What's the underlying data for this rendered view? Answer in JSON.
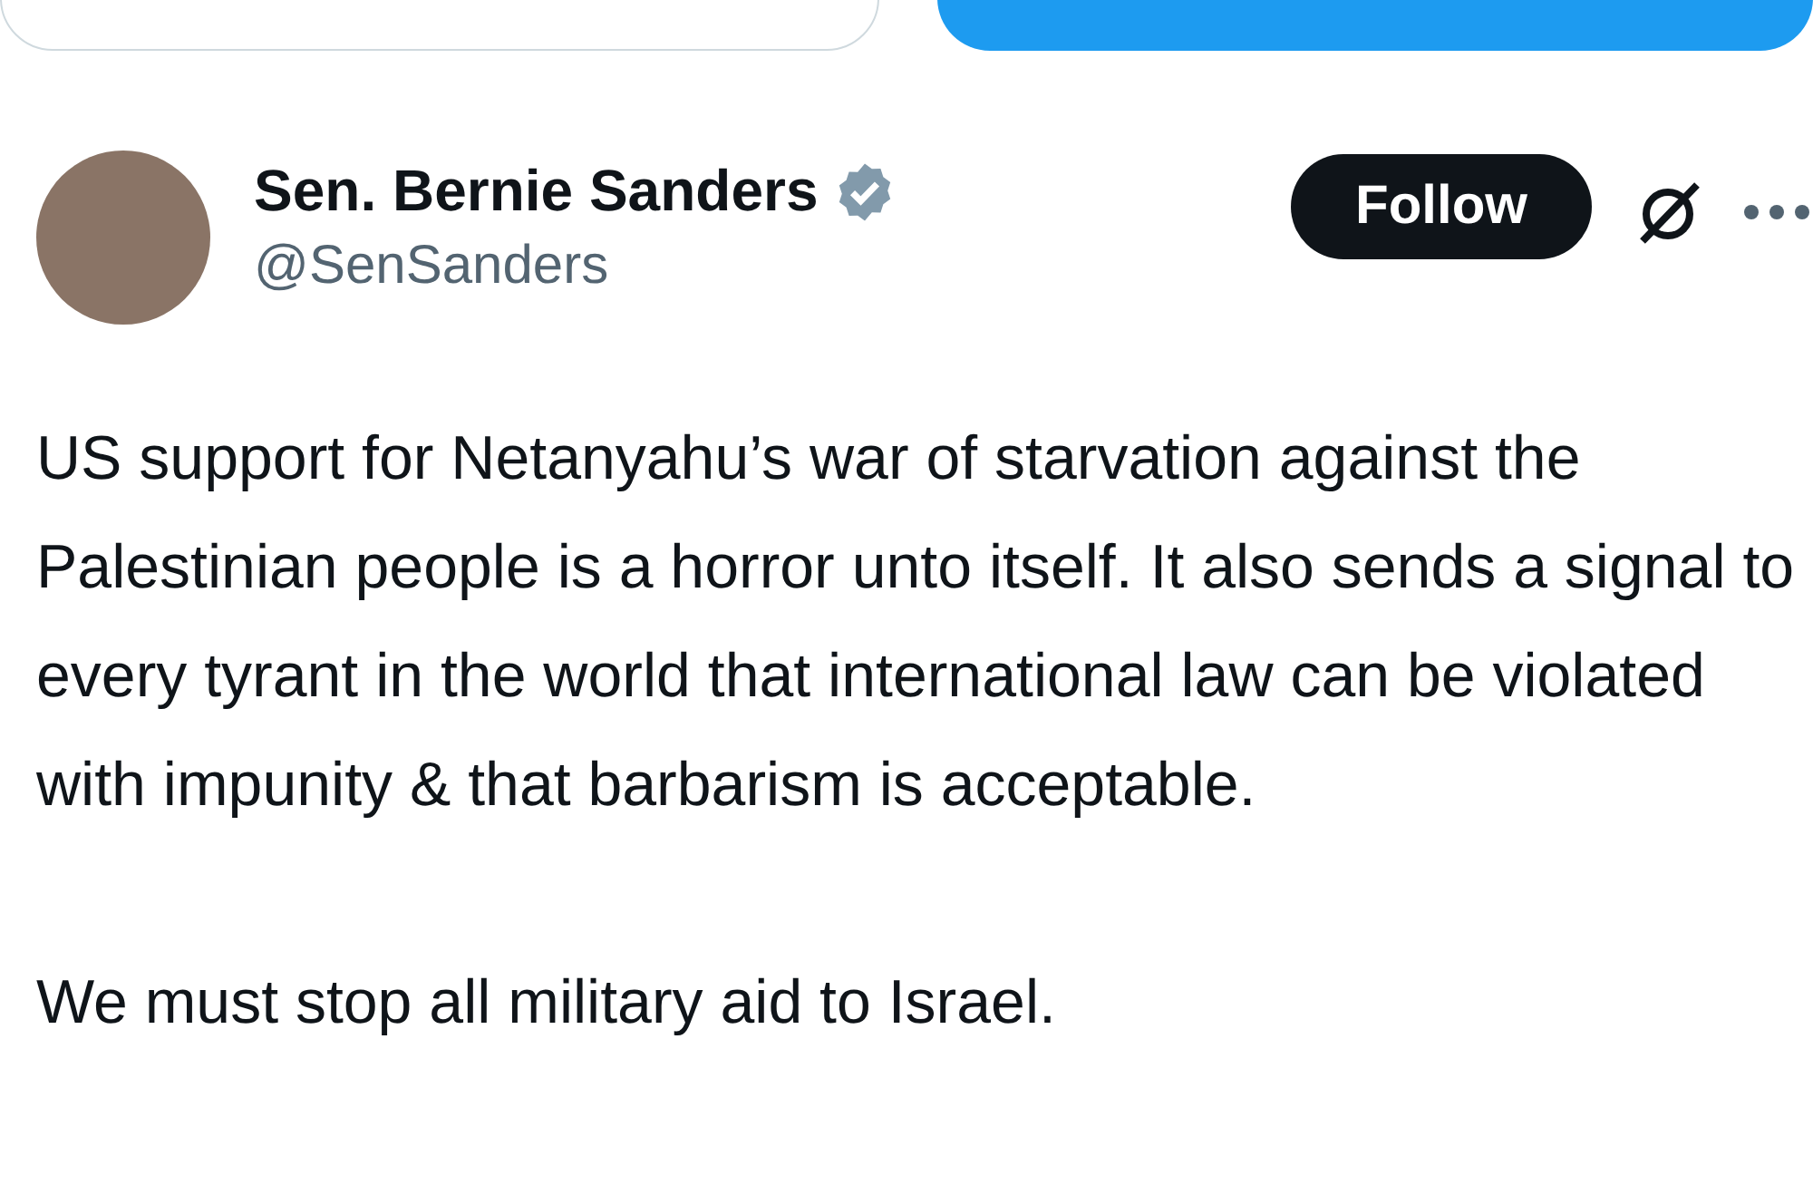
{
  "top_buttons": [
    {
      "kind": "outline"
    },
    {
      "kind": "filled"
    }
  ],
  "author": {
    "name": "Sen. Bernie Sanders",
    "verified": true,
    "handle": "@SenSanders"
  },
  "follow_button": "Follow",
  "paragraphs": [
    "US support for Netanyahu’s war of starvation against the Palestinian people is a horror unto itself. It also sends a signal to every tyrant in the world that international law can be violated with impunity & that barbarism is acceptable.",
    "We must stop all military aid to Israel."
  ]
}
